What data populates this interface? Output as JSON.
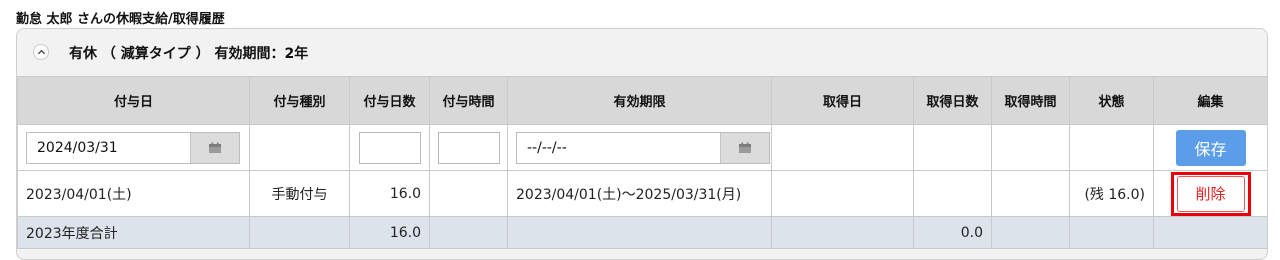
{
  "page_title": "勤怠 太郎 さんの休暇支給/取得履歴",
  "panel": {
    "title": "有休 （ 減算タイプ ） 有効期間：2年"
  },
  "table": {
    "headers": [
      "付与日",
      "付与種別",
      "付与日数",
      "付与時間",
      "有効期限",
      "取得日",
      "取得日数",
      "取得時間",
      "状態",
      "編集"
    ],
    "input_row": {
      "grant_date": "2024/03/31",
      "expiry_date_placeholder": "--/--/--",
      "save_label": "保存"
    },
    "record": {
      "grant_date": "2023/04/01(土)",
      "grant_type": "手動付与",
      "grant_days": "16.0",
      "grant_hours": "",
      "expiry": "2023/04/01(土)〜2025/03/31(月)",
      "acquired_date": "",
      "acquired_days": "",
      "acquired_hours": "",
      "status": "(残 16.0)",
      "delete_label": "削除"
    },
    "total": {
      "label": "2023年度合計",
      "grant_days": "16.0",
      "acquired_days": "0.0"
    }
  },
  "icons": {
    "collapse": "chevron-up-icon",
    "calendar": "calendar-icon"
  },
  "colors": {
    "save_button": "#5b9de8",
    "delete_highlight": "#e8000b",
    "header_bg": "#d8d8d8",
    "total_row_bg": "#dde3ea"
  }
}
